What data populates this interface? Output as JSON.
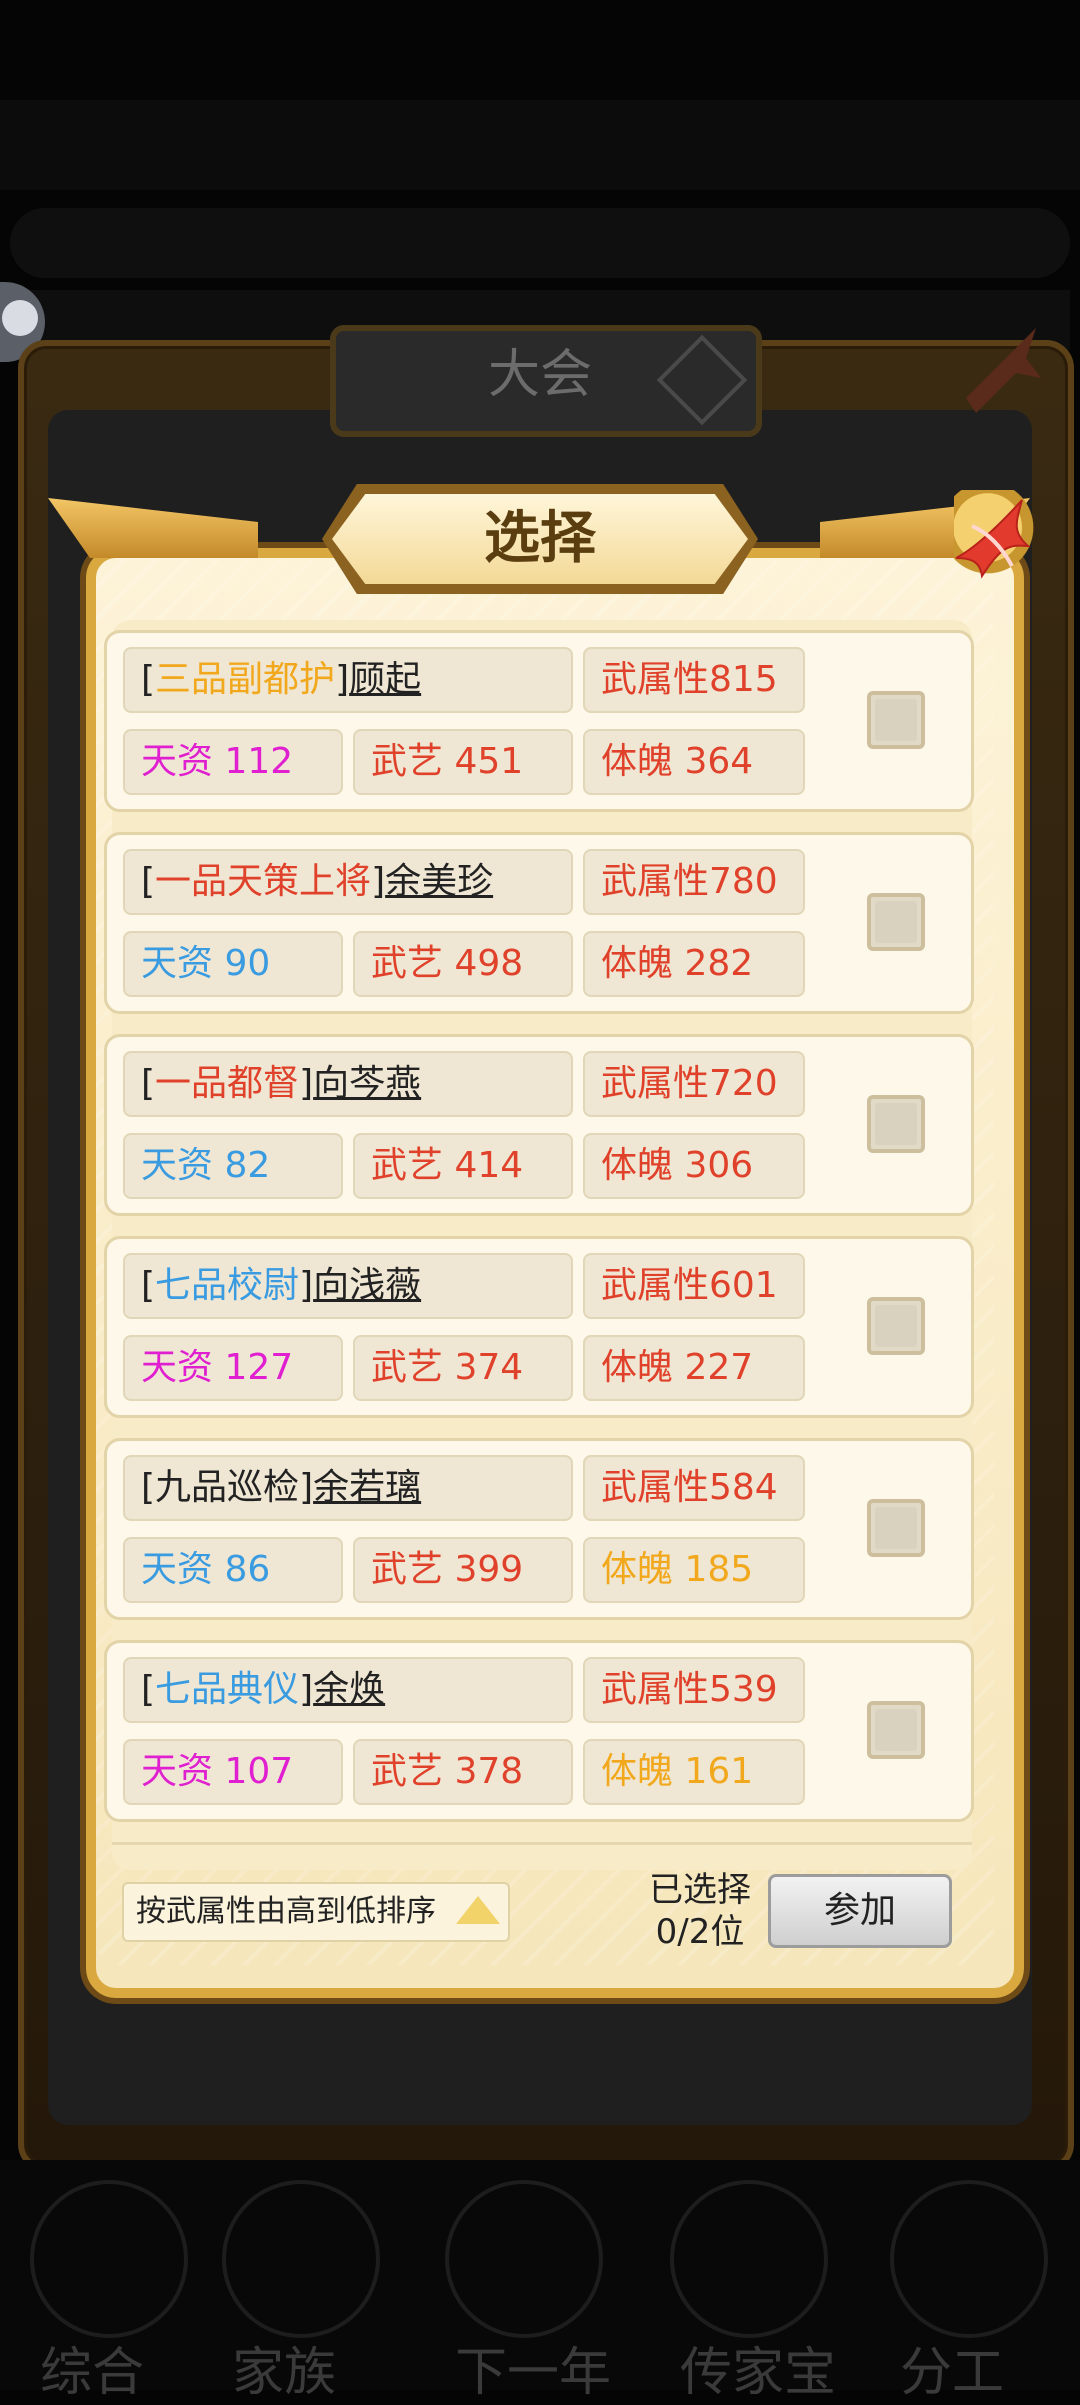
{
  "outer_title": "大会",
  "title": "选择",
  "colors": {
    "gold": "#e5a020",
    "red": "#e0412a",
    "blue": "#3a9be0",
    "magenta": "#e020d0",
    "orange": "#f2a81d",
    "dark": "#222222"
  },
  "cards": [
    {
      "rank": "三品副都护",
      "rank_color": "#f2a81d",
      "name": "顾起",
      "attr": "武属性815",
      "tz": "天资 112",
      "tz_color": "#e020d0",
      "wy": "武艺 451",
      "tp": "体魄 364",
      "tp_color": "#e0412a"
    },
    {
      "rank": "一品天策上将",
      "rank_color": "#e0412a",
      "name": "余美珍",
      "attr": "武属性780",
      "tz": "天资 90",
      "tz_color": "#3a9be0",
      "wy": "武艺 498",
      "tp": "体魄 282",
      "tp_color": "#e0412a"
    },
    {
      "rank": "一品都督",
      "rank_color": "#e0412a",
      "name": "向芩燕",
      "attr": "武属性720",
      "tz": "天资 82",
      "tz_color": "#3a9be0",
      "wy": "武艺 414",
      "tp": "体魄 306",
      "tp_color": "#e0412a"
    },
    {
      "rank": "七品校尉",
      "rank_color": "#3a9be0",
      "name": "向浅薇",
      "attr": "武属性601",
      "tz": "天资 127",
      "tz_color": "#e020d0",
      "wy": "武艺 374",
      "tp": "体魄 227",
      "tp_color": "#e0412a"
    },
    {
      "rank": "九品巡检",
      "rank_color": "#222222",
      "name": "余若璃",
      "attr": "武属性584",
      "tz": "天资 86",
      "tz_color": "#3a9be0",
      "wy": "武艺 399",
      "tp": "体魄 185",
      "tp_color": "#f2a81d"
    },
    {
      "rank": "七品典仪",
      "rank_color": "#3a9be0",
      "name": "余焕",
      "attr": "武属性539",
      "tz": "天资 107",
      "tz_color": "#e020d0",
      "wy": "武艺 378",
      "tp": "体魄 161",
      "tp_color": "#f2a81d"
    }
  ],
  "footer": {
    "sort_label": "按武属性由高到低排序",
    "selected_label": "已选择",
    "selected_count": "0/2位",
    "join_label": "参加"
  },
  "nav": [
    "综合",
    "家族",
    "下一年",
    "传家宝",
    "分工"
  ]
}
